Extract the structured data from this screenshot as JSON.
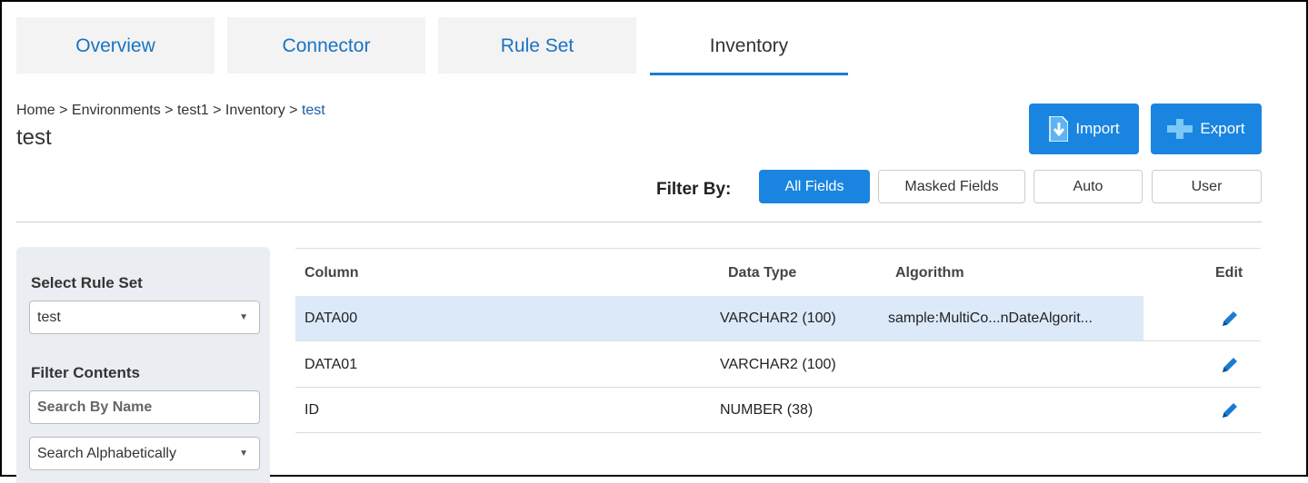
{
  "tabs": [
    {
      "label": "Overview",
      "active": false
    },
    {
      "label": "Connector",
      "active": false
    },
    {
      "label": "Rule Set",
      "active": false
    },
    {
      "label": "Inventory",
      "active": true
    }
  ],
  "breadcrumb": {
    "path": "Home > Environments > test1 > Inventory > ",
    "current": "test"
  },
  "page_title": "test",
  "actions": {
    "import_label": "Import",
    "export_label": "Export",
    "import_icon": "download-arrow-icon",
    "export_icon": "plus-icon"
  },
  "filter": {
    "label": "Filter By:",
    "options": [
      "All Fields",
      "Masked Fields",
      "Auto",
      "User"
    ],
    "selected": "All Fields"
  },
  "sidebar": {
    "rule_set_heading": "Select Rule Set",
    "rule_set_value": "test",
    "filter_heading": "Filter Contents",
    "search_placeholder": "Search By Name",
    "sort_value": "Search Alphabetically"
  },
  "table": {
    "headers": {
      "column": "Column",
      "data_type": "Data Type",
      "algorithm": "Algorithm",
      "edit": "Edit"
    },
    "rows": [
      {
        "column": "DATA00",
        "data_type": "VARCHAR2 (100)",
        "algorithm": "sample:MultiCo...nDateAlgorit...",
        "selected": true
      },
      {
        "column": "DATA01",
        "data_type": "VARCHAR2 (100)",
        "algorithm": "",
        "selected": false
      },
      {
        "column": "ID",
        "data_type": "NUMBER (38)",
        "algorithm": "",
        "selected": false
      }
    ]
  },
  "colors": {
    "accent": "#1a85e0",
    "tab_text": "#1a73c2",
    "selected_row": "#dce9f8",
    "sidebar_bg": "#eaedf2"
  }
}
